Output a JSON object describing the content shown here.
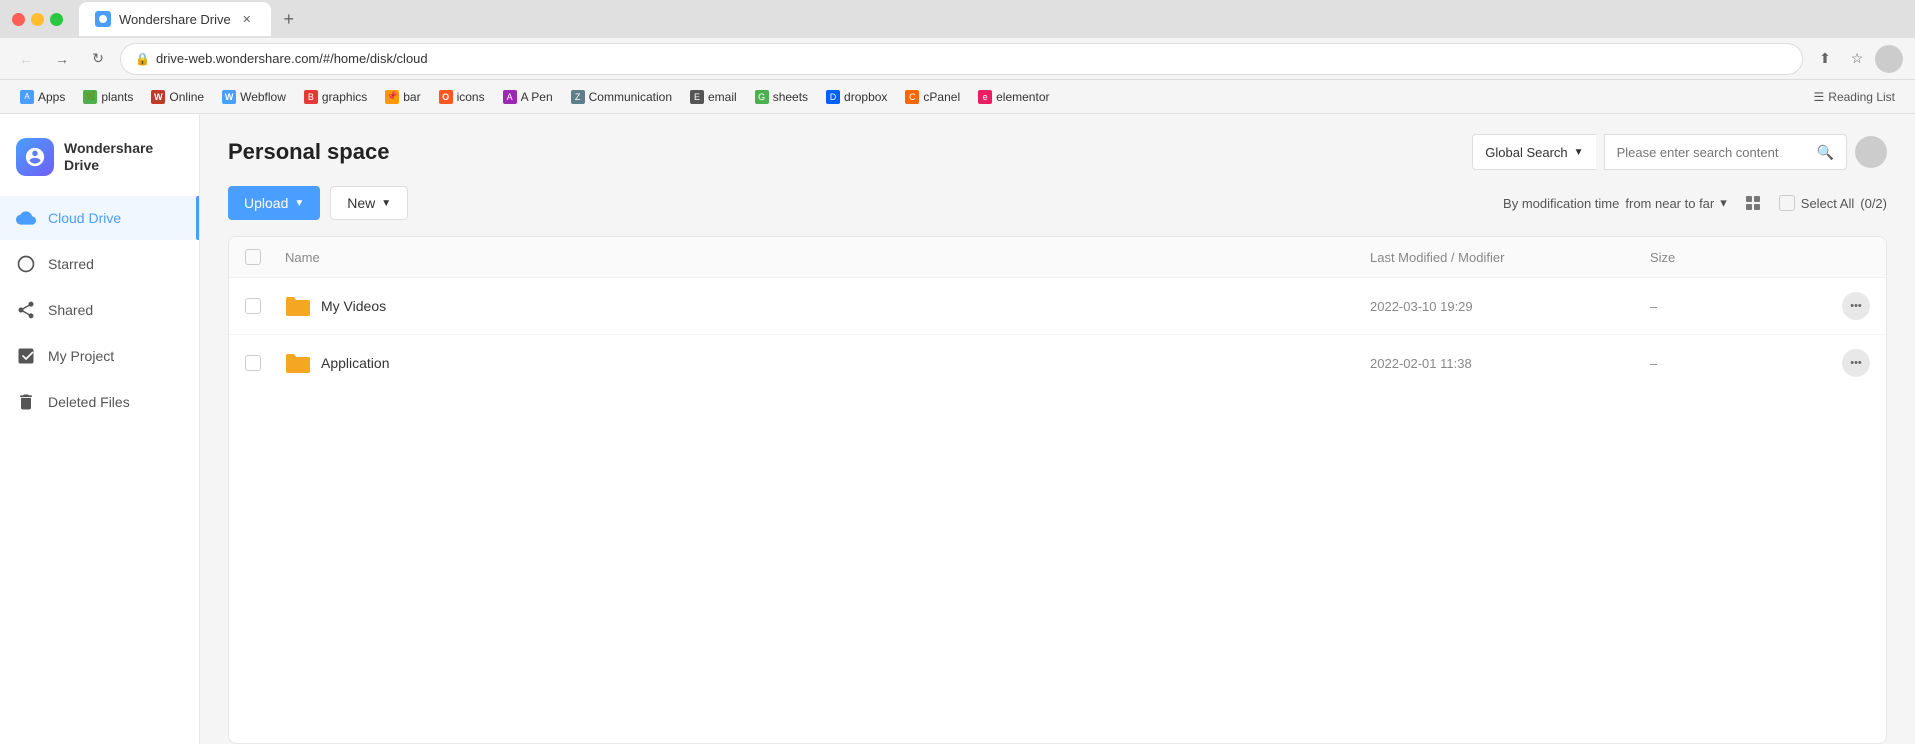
{
  "browser": {
    "traffic_lights": [
      "red",
      "yellow",
      "green"
    ],
    "tab": {
      "title": "Wondershare Drive",
      "url": "drive-web.wondershare.com/#/home/disk/cloud"
    },
    "bookmarks": [
      {
        "label": "Apps",
        "icon": "🅐",
        "color": "#4a9eff"
      },
      {
        "label": "plants",
        "icon": "🌿",
        "color": "#4caf50"
      },
      {
        "label": "Online",
        "icon": "W",
        "color": "#e91e63"
      },
      {
        "label": "Webflow",
        "icon": "W",
        "color": "#4a9eff"
      },
      {
        "label": "graphics",
        "icon": "B",
        "color": "#f44336"
      },
      {
        "label": "bar",
        "icon": "📌",
        "color": "#ff9800"
      },
      {
        "label": "icons",
        "icon": "O",
        "color": "#ff5722"
      },
      {
        "label": "A Pen",
        "icon": "A",
        "color": "#9c27b0"
      },
      {
        "label": "Communication",
        "icon": "Z",
        "color": "#607d8b"
      },
      {
        "label": "email",
        "icon": "E",
        "color": "#555"
      },
      {
        "label": "sheets",
        "icon": "G",
        "color": "#4caf50"
      },
      {
        "label": "dropbox",
        "icon": "D",
        "color": "#0061ff"
      },
      {
        "label": "cPanel",
        "icon": "C",
        "color": "#ff6600"
      },
      {
        "label": "elementor",
        "icon": "e",
        "color": "#e91e63"
      }
    ],
    "reading_list": "Reading List"
  },
  "sidebar": {
    "logo_text_line1": "Wondershare",
    "logo_text_line2": "Drive",
    "items": [
      {
        "label": "Cloud Drive",
        "active": true
      },
      {
        "label": "Starred",
        "active": false
      },
      {
        "label": "Shared",
        "active": false
      },
      {
        "label": "My Project",
        "active": false
      },
      {
        "label": "Deleted Files",
        "active": false
      }
    ]
  },
  "header": {
    "page_title": "Personal space",
    "search_dropdown_label": "Global Search",
    "search_placeholder": "Please enter search content"
  },
  "toolbar": {
    "upload_label": "Upload",
    "new_label": "New",
    "sort_label": "By modification time",
    "sort_direction": "from near to far",
    "select_all_label": "Select All",
    "select_all_count": "(0/2)"
  },
  "table": {
    "columns": {
      "name": "Name",
      "modified": "Last Modified / Modifier",
      "size": "Size"
    },
    "rows": [
      {
        "name": "My Videos",
        "modified": "2022-03-10 19:29",
        "size": "–"
      },
      {
        "name": "Application",
        "modified": "2022-02-01 11:38",
        "size": "–"
      }
    ]
  }
}
